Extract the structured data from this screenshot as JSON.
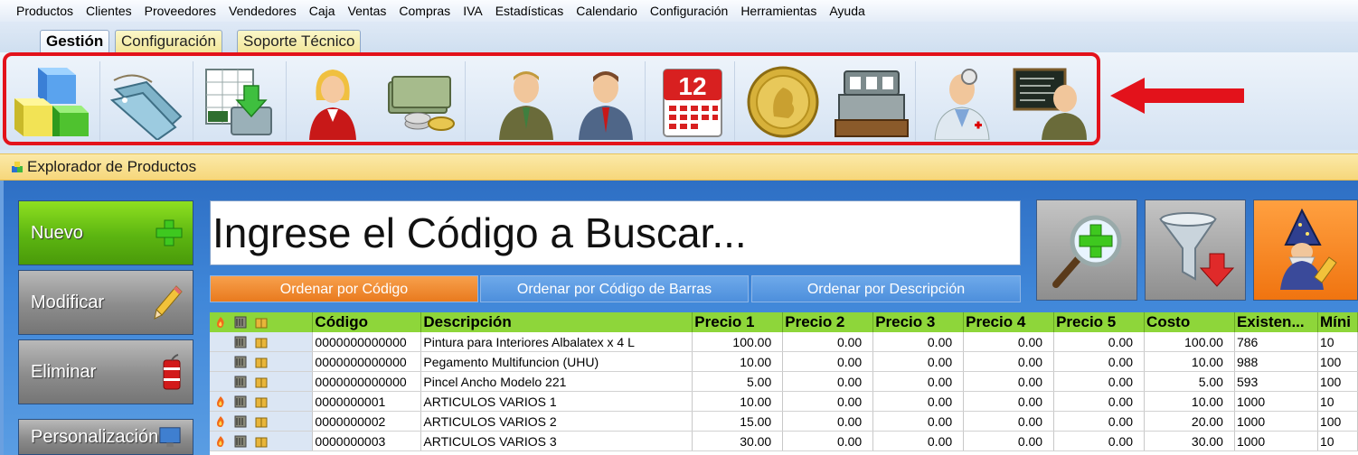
{
  "menu": [
    "Productos",
    "Clientes",
    "Proveedores",
    "Vendedores",
    "Caja",
    "Ventas",
    "Compras",
    "IVA",
    "Estadísticas",
    "Calendario",
    "Configuración",
    "Herramientas",
    "Ayuda"
  ],
  "tabs": [
    {
      "label": "Gestión",
      "active": true
    },
    {
      "label": "Configuración",
      "active": false
    },
    {
      "label": "Soporte Técnico",
      "active": false
    }
  ],
  "ribbon_icons": [
    "products-cubes-icon",
    "price-tags-icon",
    "excel-import-icon",
    "seller-woman-icon",
    "money-coins-icon",
    "client-man-icon",
    "supplier-man-icon",
    "calendar-icon",
    "gold-coin-icon",
    "cash-register-icon",
    "doctor-icon",
    "teacher-icon"
  ],
  "calendar_day": "12",
  "explorer_title": "Explorador de Productos",
  "side_buttons": {
    "new": "Nuevo",
    "edit": "Modificar",
    "delete": "Eliminar",
    "customize": "Personalización"
  },
  "search": {
    "placeholder": "Ingrese el Código a Buscar..."
  },
  "sort_buttons": {
    "by_code": "Ordenar por Código",
    "by_barcode": "Ordenar por Código de Barras",
    "by_description": "Ordenar por Descripción"
  },
  "table": {
    "headers": [
      "Código",
      "Descripción",
      "Precio 1",
      "Precio 2",
      "Precio 3",
      "Precio 4",
      "Precio 5",
      "Costo",
      "Existen...",
      "Míni"
    ],
    "rows": [
      {
        "flame": false,
        "cells": [
          "0000000000000",
          "Pintura para Interiores Albalatex x 4 L",
          "100.00",
          "0.00",
          "0.00",
          "0.00",
          "0.00",
          "100.00",
          "786",
          "10"
        ]
      },
      {
        "flame": false,
        "cells": [
          "0000000000000",
          "Pegamento Multifuncion (UHU)",
          "10.00",
          "0.00",
          "0.00",
          "0.00",
          "0.00",
          "10.00",
          "988",
          "100"
        ]
      },
      {
        "flame": false,
        "cells": [
          "0000000000000",
          "Pincel Ancho Modelo 221",
          "5.00",
          "0.00",
          "0.00",
          "0.00",
          "0.00",
          "5.00",
          "593",
          "100"
        ]
      },
      {
        "flame": true,
        "cells": [
          "0000000001",
          "ARTICULOS VARIOS 1",
          "10.00",
          "0.00",
          "0.00",
          "0.00",
          "0.00",
          "10.00",
          "1000",
          "10"
        ]
      },
      {
        "flame": true,
        "cells": [
          "0000000002",
          "ARTICULOS VARIOS 2",
          "15.00",
          "0.00",
          "0.00",
          "0.00",
          "0.00",
          "20.00",
          "1000",
          "100"
        ]
      },
      {
        "flame": true,
        "cells": [
          "0000000003",
          "ARTICULOS VARIOS 3",
          "30.00",
          "0.00",
          "0.00",
          "0.00",
          "0.00",
          "30.00",
          "1000",
          "10"
        ]
      }
    ]
  },
  "colors": {
    "highlight_border": "#e3121b",
    "grid_header": "#8ed63a",
    "accent_orange": "#f07410",
    "new_button": "#5cb511"
  }
}
